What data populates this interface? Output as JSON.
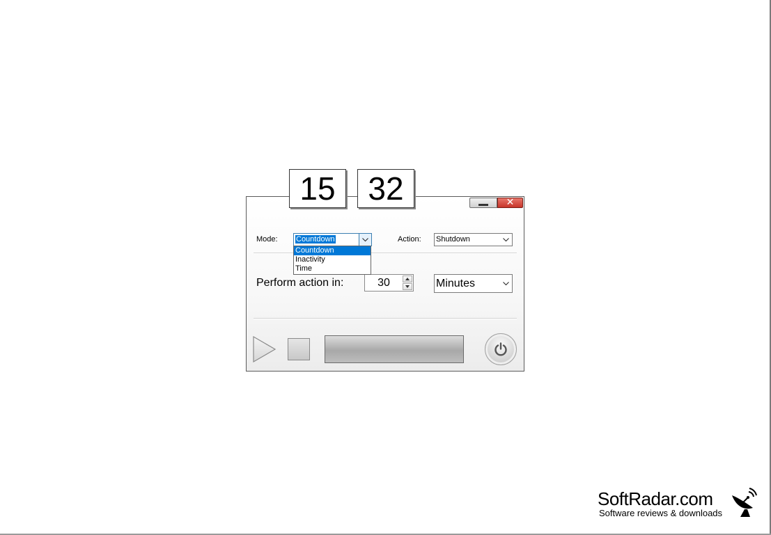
{
  "clock": {
    "hours": "15",
    "minutes": "32"
  },
  "window": {
    "minimize_icon": "minimize-icon",
    "close_glyph": "✕",
    "close_icon": "close-icon"
  },
  "mode": {
    "label": "Mode:",
    "selected": "Countdown",
    "options": [
      "Countdown",
      "Inactivity",
      "Time"
    ],
    "highlighted_index": 0
  },
  "action": {
    "label": "Action:",
    "selected": "Shutdown"
  },
  "perform": {
    "label": "Perform action in:",
    "value": "30",
    "unit": "Minutes"
  },
  "controls": {
    "play_icon": "play-icon",
    "stop_icon": "stop-icon",
    "power_icon": "power-icon",
    "progress": 0
  },
  "watermark": {
    "title": "SoftRadar.com",
    "subtitle": "Software reviews & downloads",
    "logo_icon": "satellite-dish-icon"
  },
  "colors": {
    "selection": "#0078d7",
    "close_button": "#c7352a",
    "focus_border": "#3c7fb1"
  }
}
